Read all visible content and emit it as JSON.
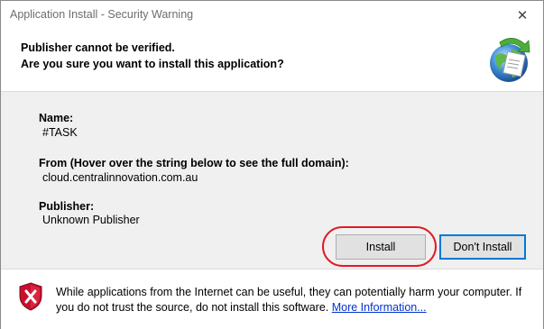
{
  "window": {
    "title": "Application Install - Security Warning",
    "close_glyph": "✕"
  },
  "header": {
    "line1": "Publisher cannot be verified.",
    "line2": "Are you sure you want to install this application?",
    "icon": "globe-install-icon"
  },
  "details": {
    "name_label": "Name:",
    "name_value": "#TASK",
    "from_label": "From (Hover over the string below to see the full domain):",
    "from_value": "cloud.centralinnovation.com.au",
    "publisher_label": "Publisher:",
    "publisher_value": "Unknown Publisher"
  },
  "buttons": {
    "install": "Install",
    "dont_install": "Don't Install"
  },
  "footer": {
    "icon": "shield-error-icon",
    "warning_text": "While applications from the Internet can be useful, they can potentially harm your computer. If you do not trust the source, do not install this software.",
    "more_info_link": "More Information..."
  },
  "colors": {
    "highlight_ring": "#e01b24",
    "default_button_border": "#0078d7",
    "link": "#0033cc",
    "shield_red": "#c8102e"
  }
}
